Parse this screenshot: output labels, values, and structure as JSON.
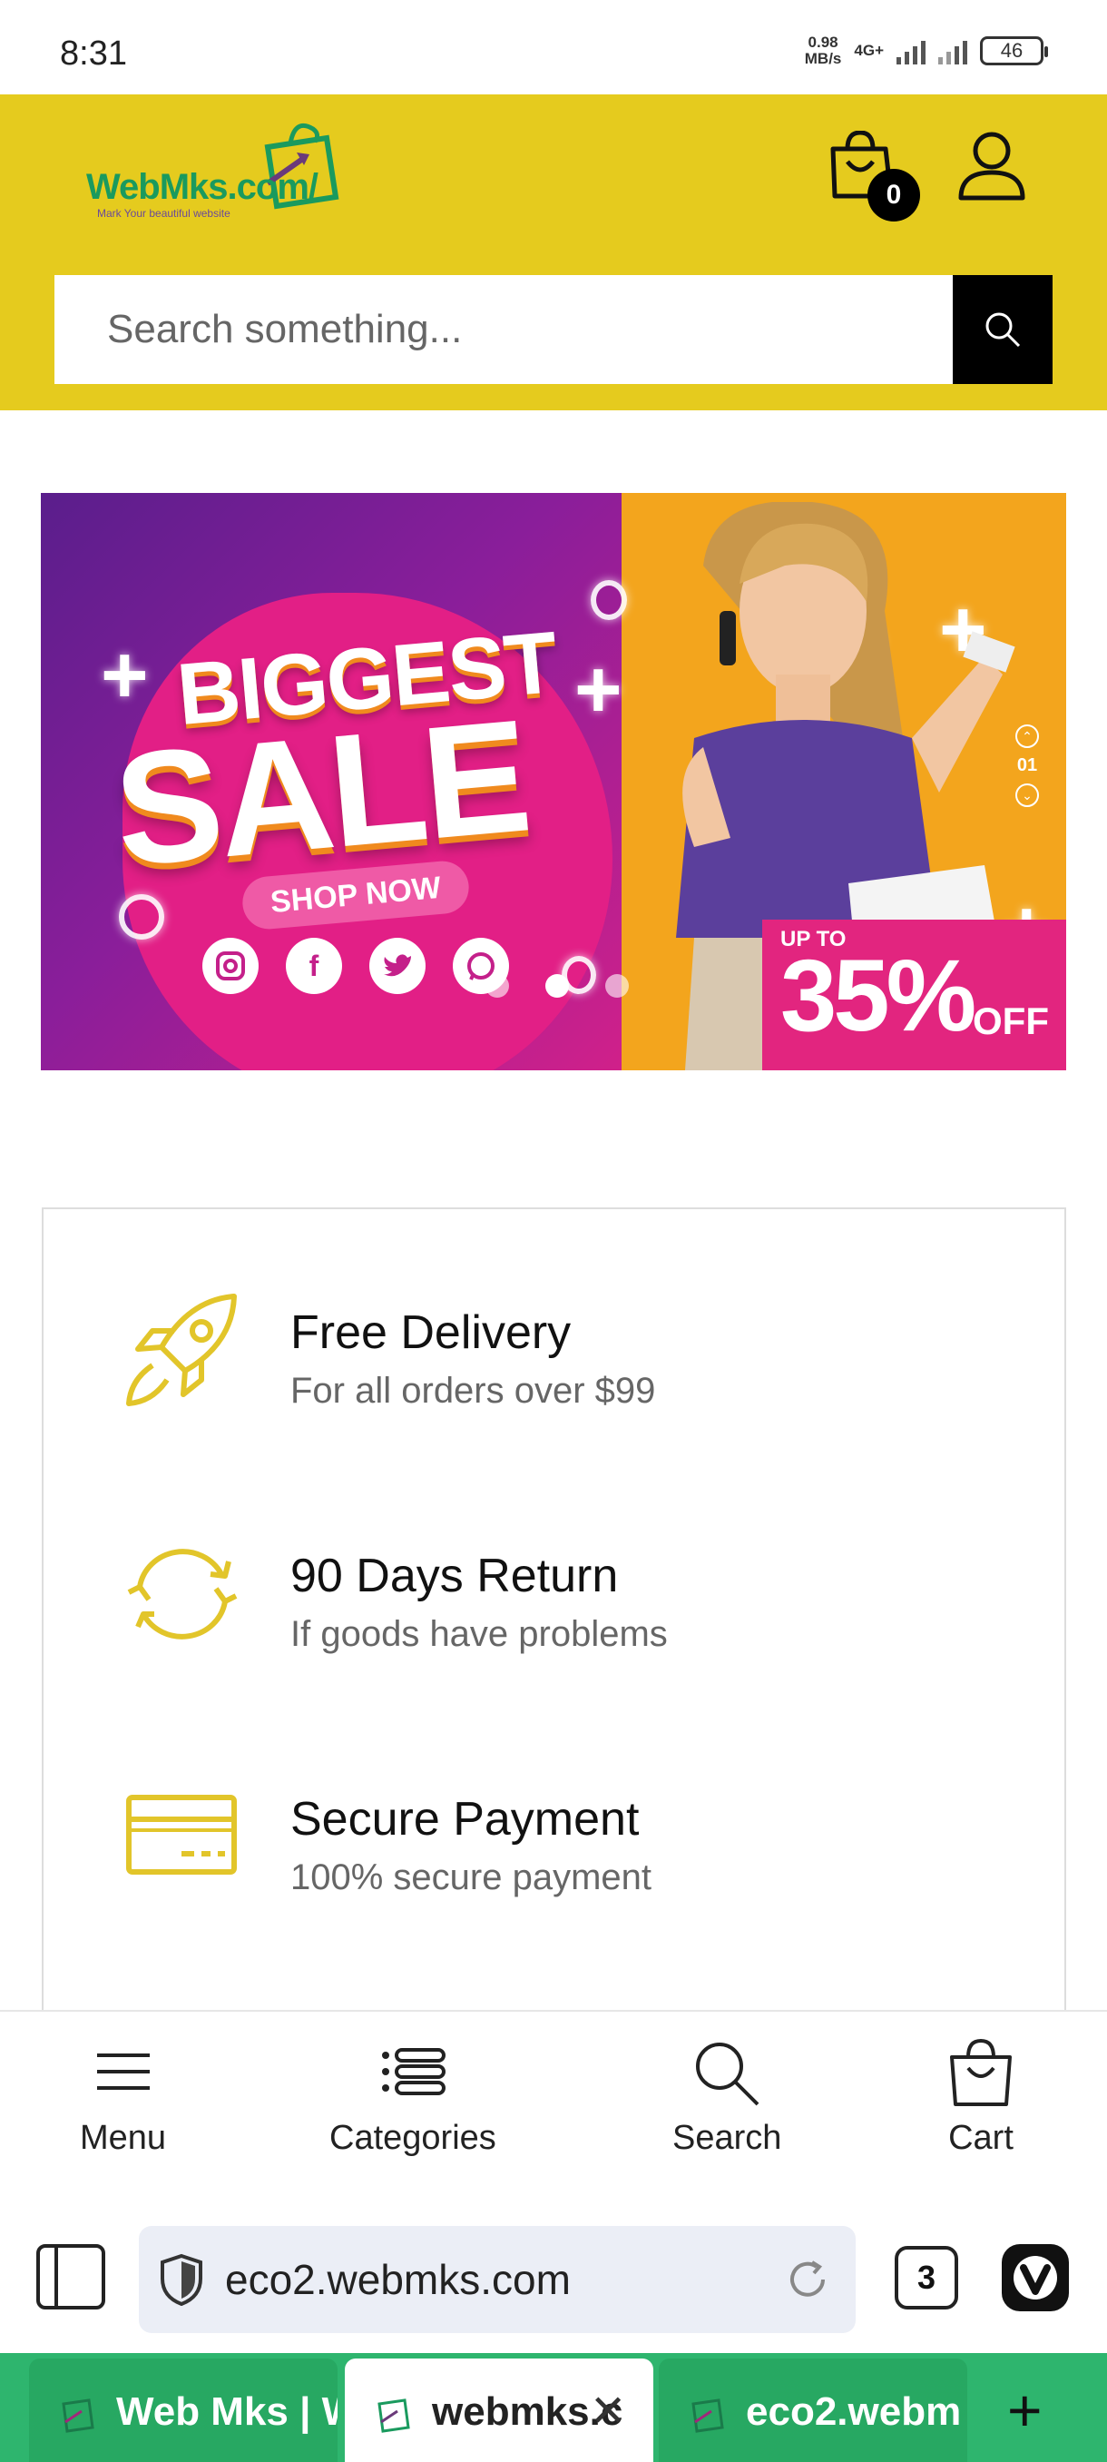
{
  "status_bar": {
    "time": "8:31",
    "net_speed_value": "0.98",
    "net_speed_unit": "MB/s",
    "net_type": "4G+",
    "battery": "46"
  },
  "header": {
    "logo_text": "WebMks.com/",
    "logo_tagline": "Mark Your beautiful website",
    "cart_count": "0",
    "search_placeholder": "Search something..."
  },
  "banner": {
    "title_line1": "BIGGEST",
    "title_line2": "SALE",
    "cta": "SHOP NOW",
    "promo_upto": "UP TO",
    "promo_percent": "35%",
    "promo_off": "OFF",
    "slide_number": "01"
  },
  "features": [
    {
      "title": "Free Delivery",
      "subtitle": "For all orders over $99",
      "icon": "rocket-icon"
    },
    {
      "title": "90 Days Return",
      "subtitle": "If goods have problems",
      "icon": "refresh-icon"
    },
    {
      "title": "Secure Payment",
      "subtitle": "100% secure payment",
      "icon": "credit-card-icon"
    }
  ],
  "bottom_nav": [
    {
      "label": "Menu",
      "icon": "hamburger-icon"
    },
    {
      "label": "Categories",
      "icon": "list-icon"
    },
    {
      "label": "Search",
      "icon": "search-icon"
    },
    {
      "label": "Cart",
      "icon": "bag-icon"
    }
  ],
  "browser": {
    "url": "eco2.webmks.com",
    "tab_count": "3"
  },
  "tabs": [
    {
      "label": "Web Mks | W"
    },
    {
      "label": "webmks.c"
    },
    {
      "label": "eco2.webm"
    }
  ],
  "colors": {
    "brand_yellow": "#e5cb1e",
    "brand_green": "#1a9a5e",
    "tab_strip": "#2eb56e"
  }
}
